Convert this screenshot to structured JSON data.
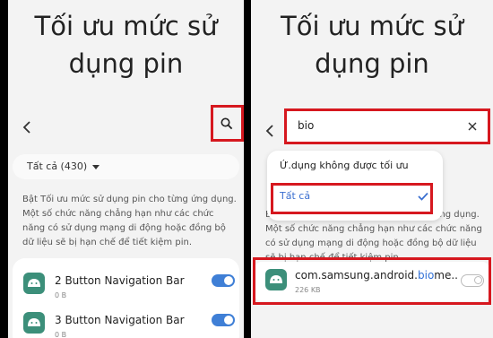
{
  "left": {
    "title": "Tối ưu mức sử dụng pin",
    "back_icon": "chevron-left-icon",
    "search_icon": "search-icon",
    "filter_label": "Tất cả (430)",
    "description": "Bật Tối ưu mức sử dụng pin cho từng ứng dụng. Một số chức năng chẳng hạn như các chức năng có sử dụng mạng di động hoặc đồng bộ dữ liệu sẽ bị hạn chế để tiết kiệm pin.",
    "apps": [
      {
        "name": "2 Button Navigation Bar",
        "size": "0 B",
        "enabled": true
      },
      {
        "name": "3 Button Navigation Bar",
        "size": "0 B",
        "enabled": true
      }
    ]
  },
  "right": {
    "title": "Tối ưu mức sử dụng pin",
    "search_value": "bio",
    "dropdown": {
      "option_not_optimized": "Ứ.dụng không được tối ưu",
      "option_all": "Tất cả"
    },
    "description": "Bật Tối ưu mức sử dụng pin cho từng ứng dụng. Một số chức năng chẳng hạn như các chức năng có sử dụng mạng di động hoặc đồng bộ dữ liệu sẽ bị hạn chế để tiết kiệm pin.",
    "result": {
      "name_prefix": "com.samsung.android.",
      "name_match": "bio",
      "name_suffix": "me..",
      "size": "226 KB",
      "enabled": false
    }
  },
  "colors": {
    "highlight_box": "#d6181f",
    "accent": "#3f7fd6",
    "app_icon": "#3c8f7a"
  }
}
